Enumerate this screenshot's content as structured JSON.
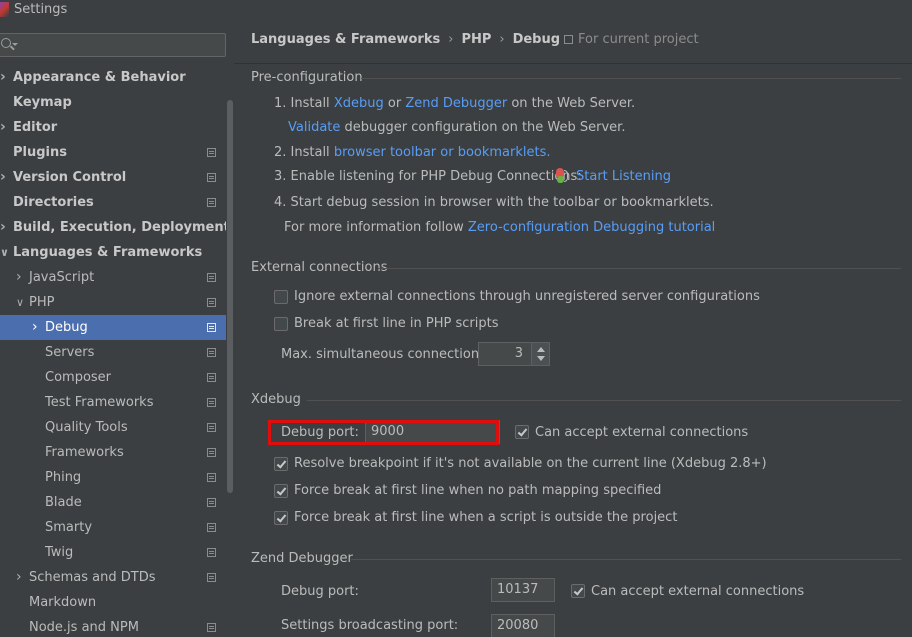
{
  "window": {
    "title": "Settings"
  },
  "sidebar": {
    "search": {
      "placeholder": ""
    },
    "items": [
      {
        "label": "Appearance & Behavior",
        "bold": true,
        "chevron": "right",
        "indent": 0,
        "proj": false
      },
      {
        "label": "Keymap",
        "bold": true,
        "chevron": "",
        "indent": 0,
        "proj": false
      },
      {
        "label": "Editor",
        "bold": true,
        "chevron": "right",
        "indent": 0,
        "proj": false
      },
      {
        "label": "Plugins",
        "bold": true,
        "chevron": "",
        "indent": 0,
        "proj": true
      },
      {
        "label": "Version Control",
        "bold": true,
        "chevron": "right",
        "indent": 0,
        "proj": true
      },
      {
        "label": "Directories",
        "bold": true,
        "chevron": "",
        "indent": 0,
        "proj": true
      },
      {
        "label": "Build, Execution, Deployment",
        "bold": true,
        "chevron": "right",
        "indent": 0,
        "proj": false
      },
      {
        "label": "Languages & Frameworks",
        "bold": true,
        "chevron": "down",
        "indent": 0,
        "proj": false
      },
      {
        "label": "JavaScript",
        "bold": false,
        "chevron": "right",
        "indent": 1,
        "proj": true
      },
      {
        "label": "PHP",
        "bold": false,
        "chevron": "down",
        "indent": 1,
        "proj": true
      },
      {
        "label": "Debug",
        "bold": false,
        "chevron": "right",
        "indent": 2,
        "proj": true,
        "selected": true
      },
      {
        "label": "Servers",
        "bold": false,
        "chevron": "",
        "indent": 2,
        "proj": true
      },
      {
        "label": "Composer",
        "bold": false,
        "chevron": "",
        "indent": 2,
        "proj": true
      },
      {
        "label": "Test Frameworks",
        "bold": false,
        "chevron": "",
        "indent": 2,
        "proj": true
      },
      {
        "label": "Quality Tools",
        "bold": false,
        "chevron": "",
        "indent": 2,
        "proj": true
      },
      {
        "label": "Frameworks",
        "bold": false,
        "chevron": "",
        "indent": 2,
        "proj": true
      },
      {
        "label": "Phing",
        "bold": false,
        "chevron": "",
        "indent": 2,
        "proj": true
      },
      {
        "label": "Blade",
        "bold": false,
        "chevron": "",
        "indent": 2,
        "proj": true
      },
      {
        "label": "Smarty",
        "bold": false,
        "chevron": "",
        "indent": 2,
        "proj": true
      },
      {
        "label": "Twig",
        "bold": false,
        "chevron": "",
        "indent": 2,
        "proj": true
      },
      {
        "label": "Schemas and DTDs",
        "bold": false,
        "chevron": "right",
        "indent": 1,
        "proj": true
      },
      {
        "label": "Markdown",
        "bold": false,
        "chevron": "",
        "indent": 1,
        "proj": false
      },
      {
        "label": "Node.js and NPM",
        "bold": false,
        "chevron": "",
        "indent": 1,
        "proj": true
      }
    ]
  },
  "breadcrumb": {
    "part1": "Languages & Frameworks",
    "sep1": "›",
    "part2": "PHP",
    "sep2": "›",
    "part3": "Debug"
  },
  "scope": {
    "label": "For current project"
  },
  "preconfig": {
    "title": "Pre-configuration",
    "step1_prefix": "1. Install",
    "step1_link1": "Xdebug",
    "step1_or": "or",
    "step1_link2": "Zend Debugger",
    "step1_suffix": "on the Web Server.",
    "step1b_link": "Validate",
    "step1b_suffix": "debugger configuration on the Web Server.",
    "step2_prefix": "2. Install",
    "step2_link": "browser toolbar or bookmarklets.",
    "step3_prefix": "3. Enable listening for PHP Debug Connections:",
    "step3_link": "Start Listening",
    "step4": "4. Start debug session in browser with the toolbar or bookmarklets.",
    "more_prefix": "For more information follow",
    "more_link": "Zero-configuration Debugging tutorial"
  },
  "external": {
    "title": "External connections",
    "ignore_label": "Ignore external connections through unregistered server configurations",
    "ignore_checked": false,
    "break_label": "Break at first line in PHP scripts",
    "break_checked": false,
    "max_label": "Max. simultaneous connections:",
    "max_value": "3"
  },
  "xdebug": {
    "title": "Xdebug",
    "port_label": "Debug port:",
    "port_value": "9000",
    "accept_label": "Can accept external connections",
    "accept_checked": true,
    "resolve_label": "Resolve breakpoint if it's not available on the current line (Xdebug 2.8+)",
    "resolve_checked": true,
    "force_nopath_label": "Force break at first line when no path mapping specified",
    "force_nopath_checked": true,
    "force_outside_label": "Force break at first line when a script is outside the project",
    "force_outside_checked": true
  },
  "zend": {
    "title": "Zend Debugger",
    "port_label": "Debug port:",
    "port_value": "10137",
    "accept_label": "Can accept external connections",
    "accept_checked": true,
    "broadcast_label": "Settings broadcasting port:",
    "broadcast_value": "20080"
  },
  "colors": {
    "accent": "#4b6eaf",
    "link": "#589df6",
    "highlight": "#e00d0d",
    "background": "#3c3f41"
  }
}
